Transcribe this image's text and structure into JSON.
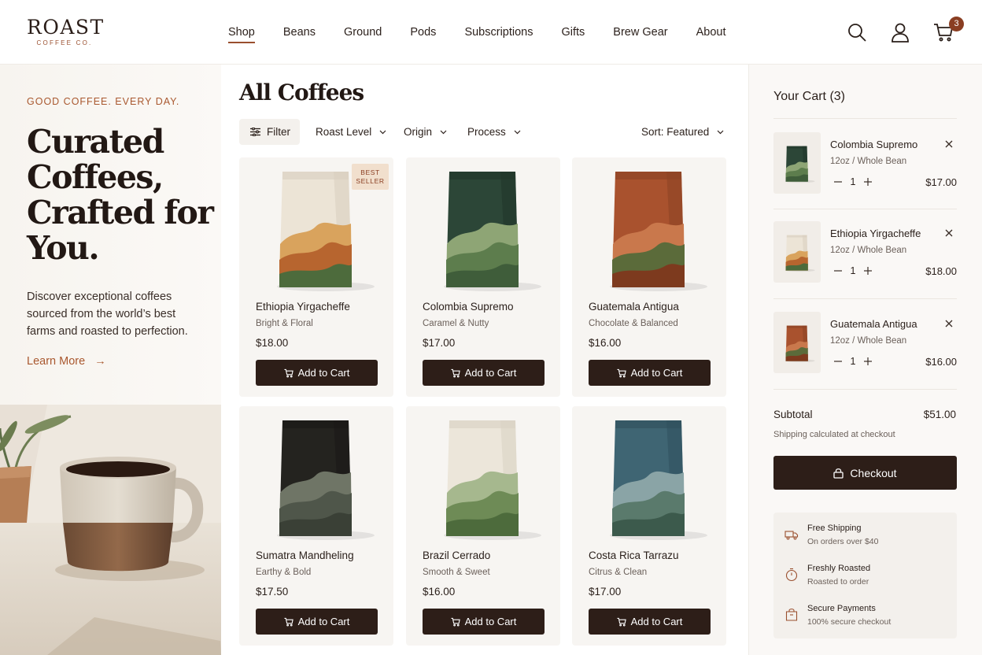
{
  "brand": {
    "name": "ROAST",
    "tagline": "COFFEE CO."
  },
  "nav": {
    "items": [
      "Shop",
      "Beans",
      "Ground",
      "Pods",
      "Subscriptions",
      "Gifts",
      "Brew Gear",
      "About"
    ],
    "active": "Shop"
  },
  "header": {
    "cart_count": "3"
  },
  "hero": {
    "eyebrow": "GOOD COFFEE. EVERY DAY.",
    "title_lines": [
      "Curated",
      "Coffees,",
      "Crafted for",
      "You."
    ],
    "copy": "Discover exceptional coffees sourced from the world’s best farms and roasted to perfection.",
    "link": "Learn More",
    "link_arrow": "→"
  },
  "main": {
    "title": "All Coffees",
    "filter_label": "Filter",
    "dropdowns": [
      "Roast Level",
      "Origin",
      "Process"
    ],
    "sort_label": "Sort: Featured",
    "add_label": "Add to Cart"
  },
  "products": [
    {
      "name": "Ethiopia Yirgacheffe",
      "note": "Bright & Floral",
      "price": "$18.00",
      "badge_line1": "BEST",
      "badge_line2": "SELLER",
      "bag_color": "#ece4d6",
      "bag_dark": "#d8cebf",
      "art": [
        "#d9a35d",
        "#b7652f",
        "#4d6b3c"
      ]
    },
    {
      "name": "Colombia Supremo",
      "note": "Caramel & Nutty",
      "price": "$17.00",
      "badge_line1": "",
      "badge_line2": "",
      "bag_color": "#2c4637",
      "bag_dark": "#213529",
      "art": [
        "#8ea575",
        "#5d7d4d",
        "#3f5d3a"
      ]
    },
    {
      "name": "Guatemala Antigua",
      "note": "Chocolate & Balanced",
      "price": "$16.00",
      "badge_line1": "",
      "badge_line2": "",
      "bag_color": "#a9522e",
      "bag_dark": "#8a4224",
      "art": [
        "#c9784c",
        "#5b6b3a",
        "#7d3a1e"
      ]
    },
    {
      "name": "Sumatra Mandheling",
      "note": "Earthy & Bold",
      "price": "$17.50",
      "badge_line1": "",
      "badge_line2": "",
      "bag_color": "#24231f",
      "bag_dark": "#191815",
      "art": [
        "#6f7566",
        "#4f564a",
        "#3a4036"
      ]
    },
    {
      "name": "Brazil Cerrado",
      "note": "Smooth & Sweet",
      "price": "$16.00",
      "badge_line1": "",
      "badge_line2": "",
      "bag_color": "#ece6da",
      "bag_dark": "#d9d1c3",
      "art": [
        "#a6b88e",
        "#6e8b56",
        "#4d6b3c"
      ]
    },
    {
      "name": "Costa Rica Tarrazu",
      "note": "Citrus & Clean",
      "price": "$17.00",
      "badge_line1": "",
      "badge_line2": "",
      "bag_color": "#3f6573",
      "bag_dark": "#30505c",
      "art": [
        "#8aa4a6",
        "#5a7a6c",
        "#3c5a4c"
      ]
    }
  ],
  "cart": {
    "title": "Your Cart (3)",
    "items": [
      {
        "name": "Colombia Supremo",
        "option": "12oz / Whole Bean",
        "qty": "1",
        "price": "$17.00",
        "bag_color": "#2c4637",
        "bag_dark": "#213529",
        "art": [
          "#8ea575",
          "#5d7d4d",
          "#3f5d3a"
        ]
      },
      {
        "name": "Ethiopia Yirgacheffe",
        "option": "12oz / Whole Bean",
        "qty": "1",
        "price": "$18.00",
        "bag_color": "#ece4d6",
        "bag_dark": "#d8cebf",
        "art": [
          "#d9a35d",
          "#b7652f",
          "#4d6b3c"
        ]
      },
      {
        "name": "Guatemala Antigua",
        "option": "12oz / Whole Bean",
        "qty": "1",
        "price": "$16.00",
        "bag_color": "#a9522e",
        "bag_dark": "#8a4224",
        "art": [
          "#c9784c",
          "#5b6b3a",
          "#7d3a1e"
        ]
      }
    ],
    "subtotal_label": "Subtotal",
    "subtotal_value": "$51.00",
    "shipping_note": "Shipping calculated at checkout",
    "checkout_label": "Checkout",
    "perks": [
      {
        "title": "Free Shipping",
        "sub": "On orders over $40",
        "icon": "truck-icon"
      },
      {
        "title": "Freshly Roasted",
        "sub": "Roasted to order",
        "icon": "timer-icon"
      },
      {
        "title": "Secure Payments",
        "sub": "100% secure checkout",
        "icon": "bag-icon"
      }
    ]
  },
  "colors": {
    "accent": "#9a4f2e",
    "dark": "#2d1e18",
    "badge": "#8a3e22"
  }
}
